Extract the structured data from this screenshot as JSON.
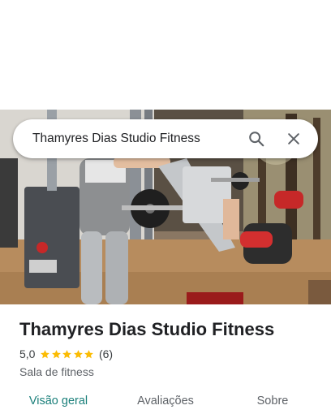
{
  "search": {
    "query": "Thamyres Dias Studio Fitness",
    "search_icon": "search-icon",
    "close_icon": "close-icon"
  },
  "photo": {
    "description_icon": "gym-photo"
  },
  "place": {
    "title": "Thamyres Dias Studio Fitness",
    "rating": "5,0",
    "stars": 5,
    "review_count": "(6)",
    "category": "Sala de fitness"
  },
  "tabs": [
    {
      "label": "Visão geral",
      "active": true
    },
    {
      "label": "Avaliações",
      "active": false
    },
    {
      "label": "Sobre",
      "active": false
    }
  ],
  "colors": {
    "accent": "#1a7f7a",
    "star": "#fbbc04",
    "text": "#202124",
    "secondary": "#5f6368"
  }
}
